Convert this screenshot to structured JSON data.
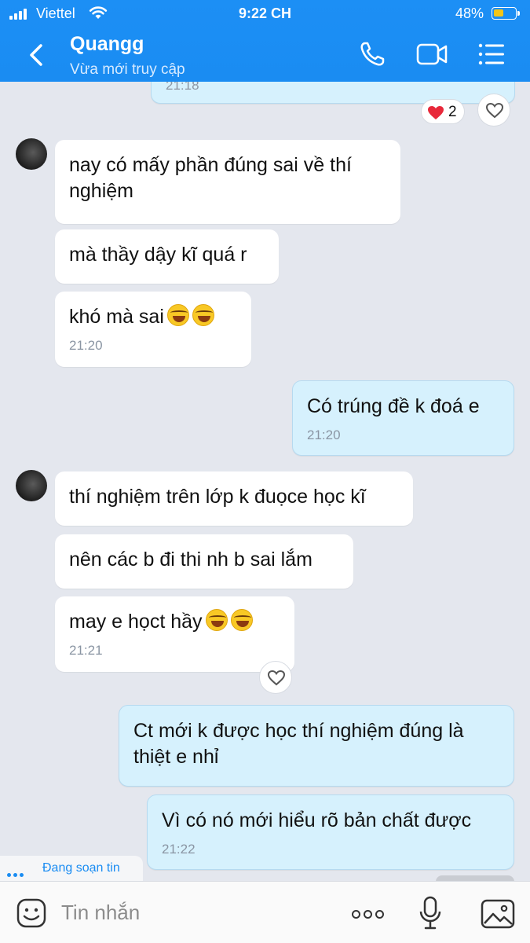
{
  "status_bar": {
    "carrier": "Viettel",
    "time": "9:22 CH",
    "battery": "48%",
    "battery_level": 0.48
  },
  "header": {
    "name": "Quangg",
    "status": "Vừa mới truy cập"
  },
  "top_partial": {
    "time": "21:18",
    "reaction_count": "2"
  },
  "messages": [
    {
      "text": "nay có mấy phần đúng sai về thí nghiệm"
    },
    {
      "text": "mà thầy dậy kĩ quá r"
    },
    {
      "text": "khó mà sai",
      "time": "21:20"
    },
    {
      "text": "Có trúng đề k đoá e",
      "time": "21:20"
    },
    {
      "text": "thí nghiệm trên lớp k đuọce học kĩ"
    },
    {
      "text": "nên các b đi thi nh b sai lắm"
    },
    {
      "text": "may e họct hầy",
      "time": "21:21"
    },
    {
      "text": "Ct mới k được học thí nghiệm đúng là thiệt e nhỉ"
    },
    {
      "text": "Vì có nó mới hiểu rõ bản chất được",
      "time": "21:22"
    }
  ],
  "typing_indicator": "Đang soạn tin",
  "input": {
    "placeholder": "Tin nhắn"
  },
  "colors": {
    "accent": "#1a8cf2",
    "incoming_bubble": "#ffffff",
    "outgoing_bubble": "#d6f1fd",
    "background": "#e4e7ee"
  },
  "icons": [
    "back-icon",
    "phone-icon",
    "video-icon",
    "menu-icon",
    "heart-icon",
    "sticker-icon",
    "more-icon",
    "mic-icon",
    "image-icon"
  ]
}
